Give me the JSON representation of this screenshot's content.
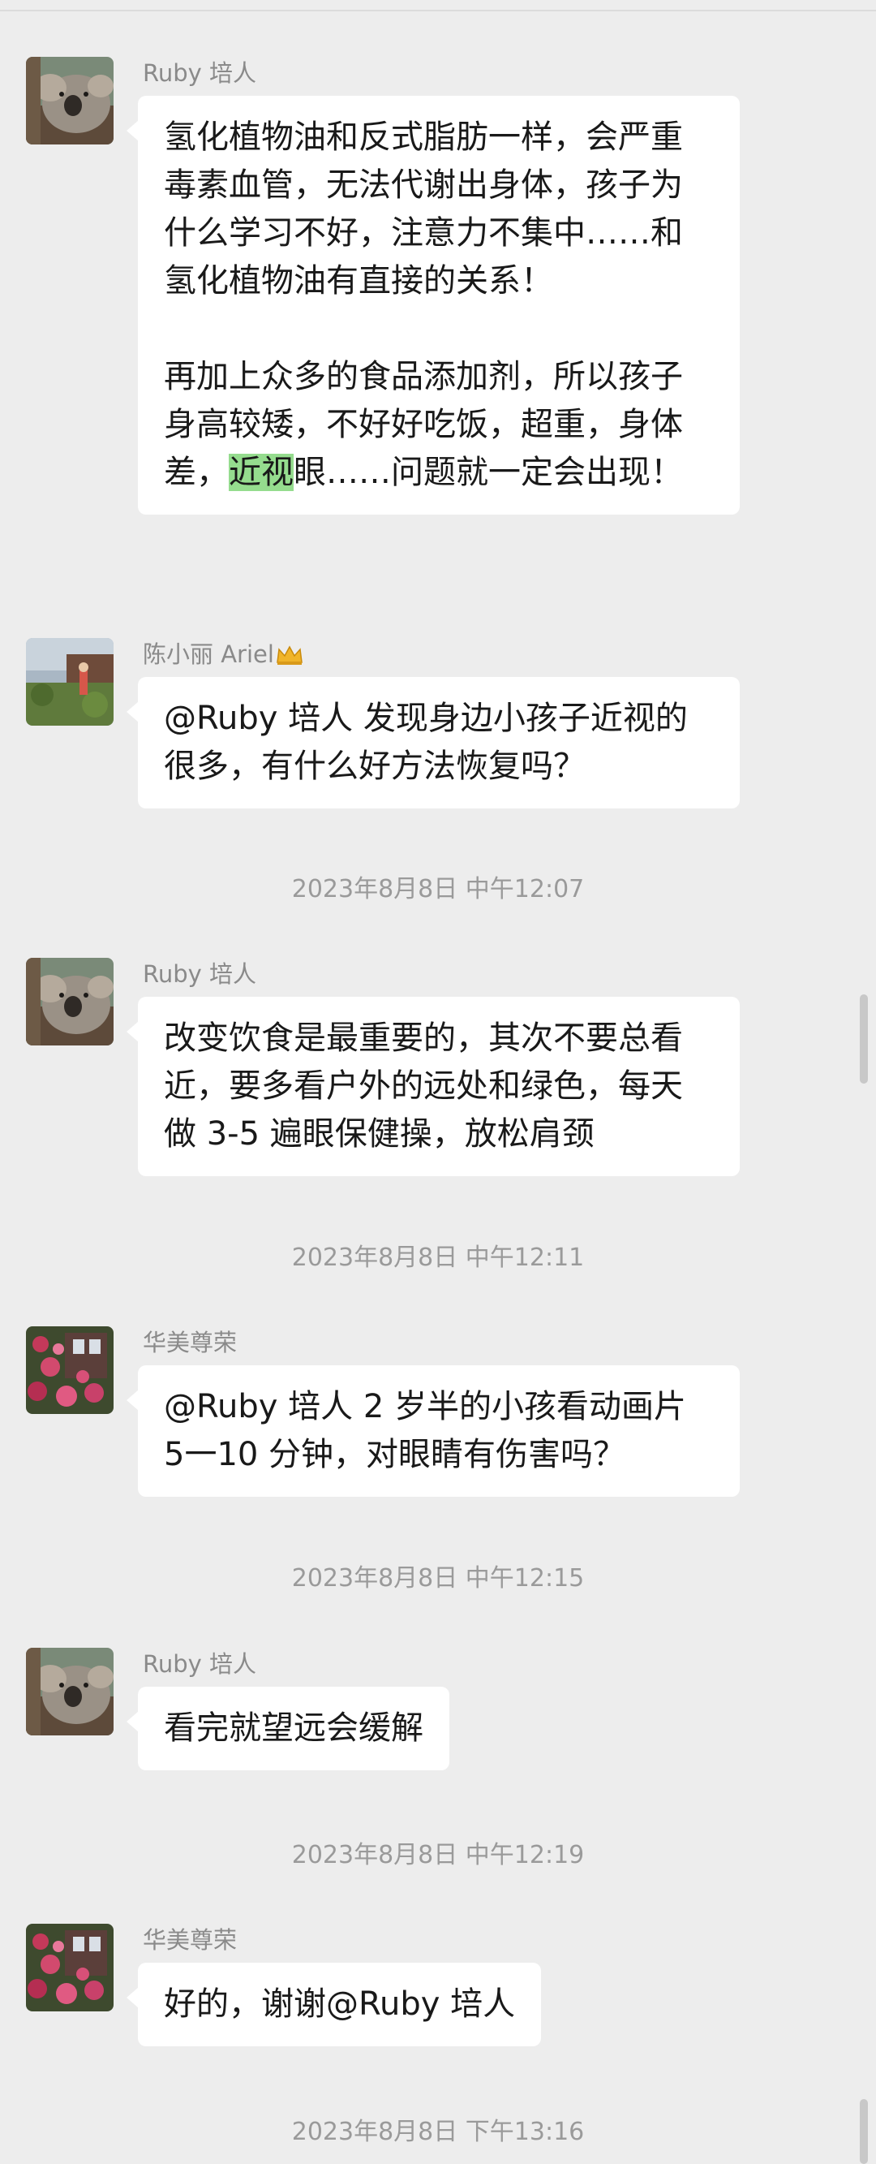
{
  "messages": [
    {
      "sender": "Ruby 培人",
      "avatar_icon": "koala-avatar-icon",
      "paragraphs": [
        "氢化植物油和反式脂肪一样，会严重毒素血管，无法代谢出身体，孩子为什么学习不好，注意力不集中……和氢化植物油有直接的关系！",
        "再加上众多的食品添加剂，所以孩子身高较矮，不好好吃饭，超重，身体差，"
      ],
      "highlight": "近视",
      "tail": "眼……问题就一定会出现！"
    },
    {
      "sender": "陈小丽 Ariel",
      "sender_badge": "crown-icon",
      "avatar_icon": "garden-avatar-icon",
      "text": "@Ruby 培人  发现身边小孩子近视的很多，有什么好方法恢复吗？"
    },
    {
      "sender": "Ruby 培人",
      "avatar_icon": "koala-avatar-icon",
      "text": "改变饮食是最重要的，其次不要总看近，要多看户外的远处和绿色，每天做 3-5 遍眼保健操，放松肩颈"
    },
    {
      "sender": "华美尊荣",
      "avatar_icon": "flowers-avatar-icon",
      "text": "@Ruby 培人  2 岁半的小孩看动画片 5一10 分钟，对眼睛有伤害吗？"
    },
    {
      "sender": "Ruby 培人",
      "avatar_icon": "koala-avatar-icon",
      "text": "看完就望远会缓解"
    },
    {
      "sender": "华美尊荣",
      "avatar_icon": "flowers-avatar-icon",
      "text": "好的，谢谢@Ruby 培人"
    }
  ],
  "timestamps": [
    "2023年8月8日 中午12:07",
    "2023年8月8日 中午12:11",
    "2023年8月8日 中午12:15",
    "2023年8月8日 中午12:19",
    "2023年8月8日 下午13:16"
  ],
  "colors": {
    "background": "#ededed",
    "bubble": "#ffffff",
    "highlight": "#95dc8e",
    "sender_text": "#8a8a8a",
    "timestamp_text": "#9a9a9a"
  }
}
